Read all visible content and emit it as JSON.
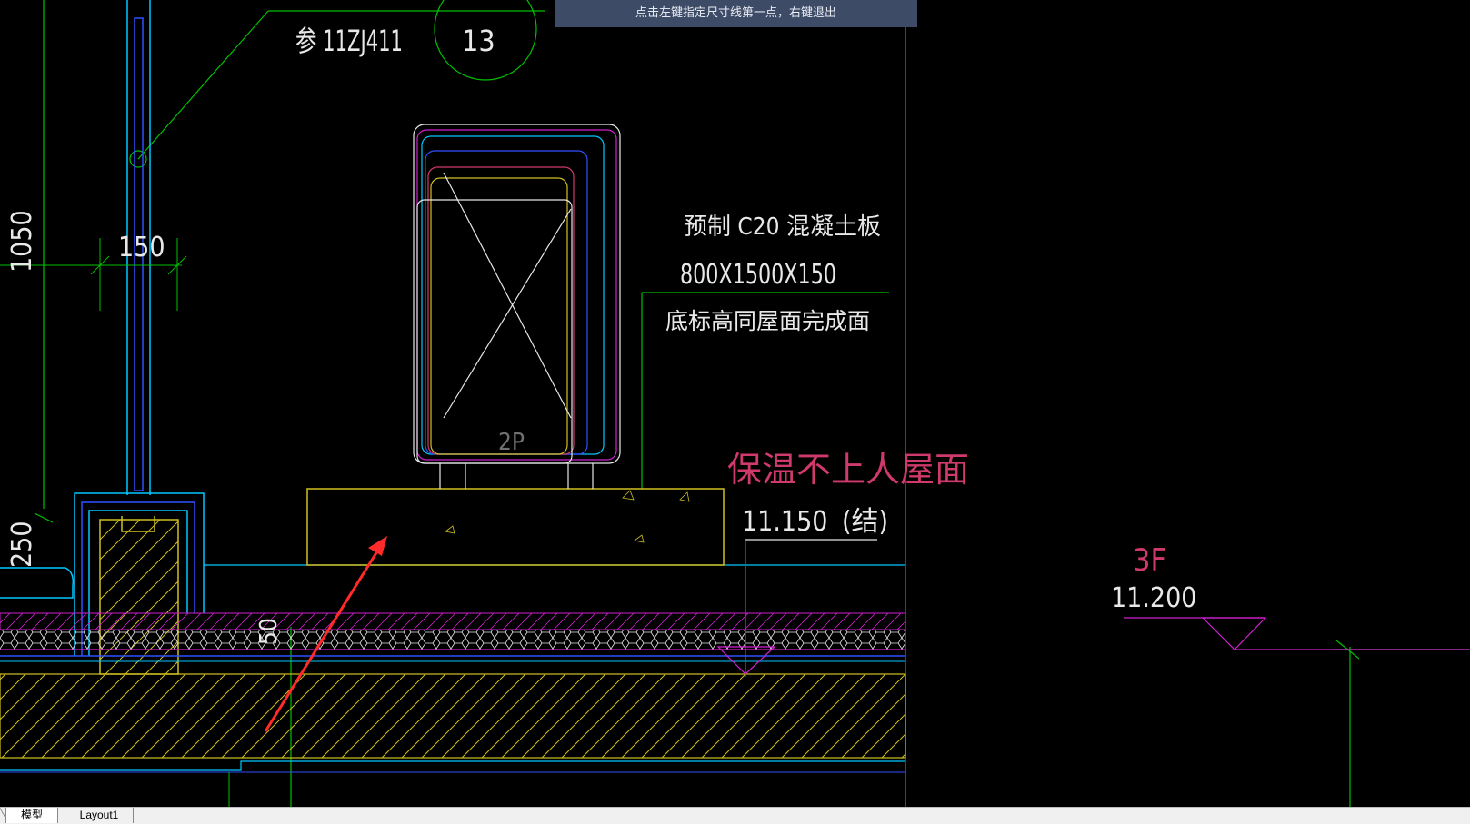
{
  "prompt": {
    "text": "点击左键指定尺寸线第一点，右键退出"
  },
  "tabs": [
    {
      "label": "模型",
      "active": true
    },
    {
      "label": "Layout1",
      "active": false
    }
  ],
  "drawing": {
    "ref_code": "参 11ZJ411",
    "detail_no": "13",
    "dim_150": "150",
    "dim_1050": "1050",
    "dim_250": "250",
    "dim_50": "50",
    "slab_line1": "预制   C20 混凝土板",
    "slab_line2": "800X1500X150",
    "slab_line3": "底标高同屋面完成面",
    "unit_label": "2P",
    "roof_label": "保温不上人屋面",
    "roof_elev": "11.150",
    "roof_elev_note": "(结)",
    "floor_label": "3F",
    "floor_elev": "11.200"
  },
  "colors": {
    "background": "#000000",
    "green": "#00c000",
    "cyan": "#00c8ff",
    "blue": "#3050ff",
    "magenta": "#d020d0",
    "yellow": "#d0c020",
    "white": "#e8e8e8",
    "red_text": "#d03a6a",
    "arrow": "#ff2a2a",
    "prompt_bg": "#3d4b66"
  }
}
